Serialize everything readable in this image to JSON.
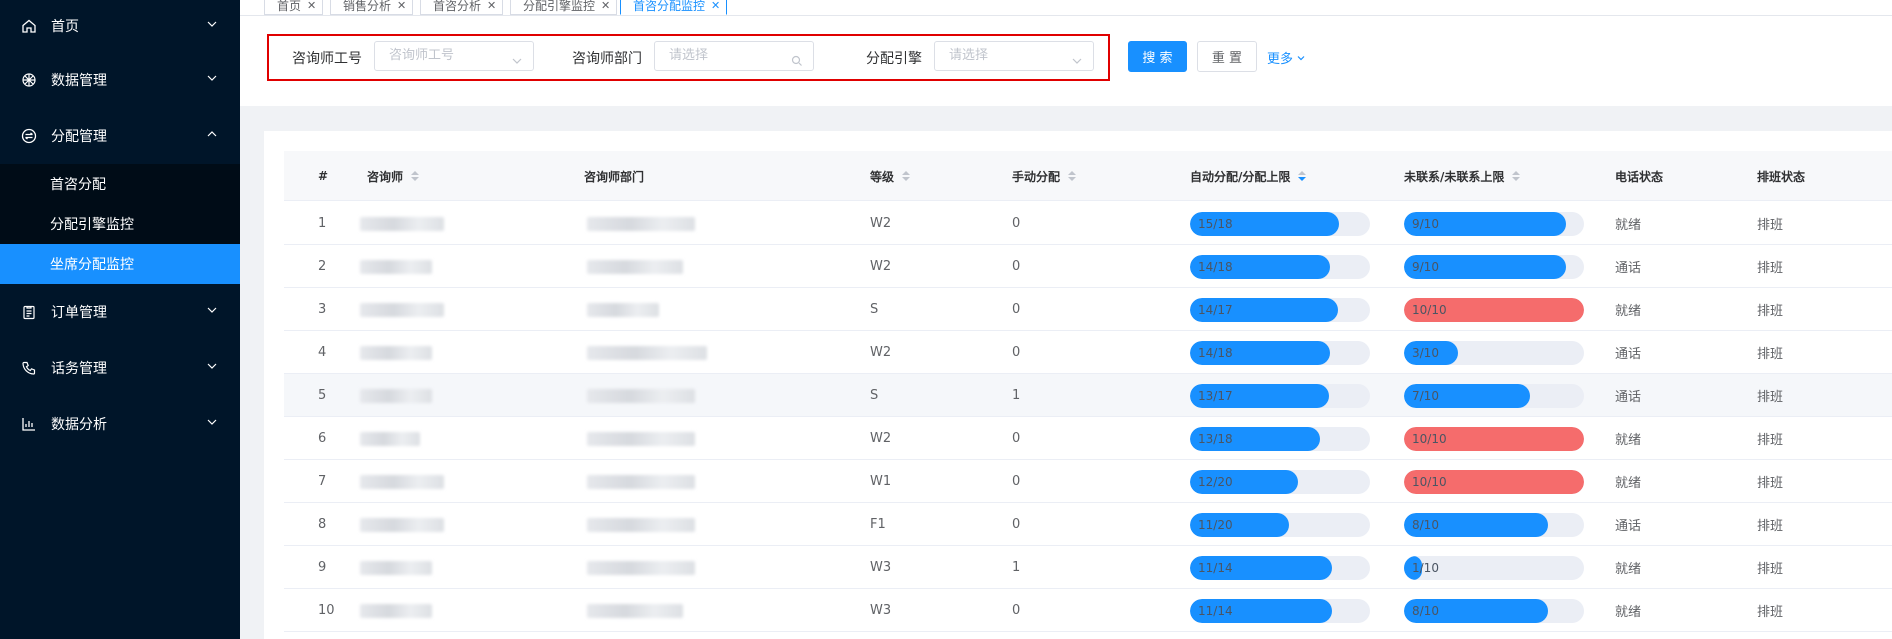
{
  "sidebar": {
    "items": [
      {
        "label": "首页",
        "icon": "home-icon",
        "expanded": false
      },
      {
        "label": "数据管理",
        "icon": "cube-icon",
        "expanded": false
      },
      {
        "label": "分配管理",
        "icon": "distribute-icon",
        "expanded": true,
        "children": [
          {
            "label": "首咨分配",
            "active": false
          },
          {
            "label": "分配引擎监控",
            "active": false
          },
          {
            "label": "坐席分配监控",
            "active": true
          }
        ]
      },
      {
        "label": "订单管理",
        "icon": "clipboard-icon",
        "expanded": false
      },
      {
        "label": "话务管理",
        "icon": "phone-icon",
        "expanded": false
      },
      {
        "label": "数据分析",
        "icon": "bar-chart-icon",
        "expanded": false
      }
    ]
  },
  "tabs": [
    {
      "label": "首页",
      "active": false
    },
    {
      "label": "销售分析",
      "active": false
    },
    {
      "label": "首咨分析",
      "active": false
    },
    {
      "label": "分配引擎监控",
      "active": false
    },
    {
      "label": "首咨分配监控",
      "active": true
    }
  ],
  "search": {
    "field1": {
      "label": "咨询师工号",
      "placeholder": "咨询师工号"
    },
    "field2": {
      "label": "咨询师部门",
      "placeholder": "请选择"
    },
    "field3": {
      "label": "分配引擎",
      "placeholder": "请选择"
    },
    "search_btn": "搜 索",
    "reset_btn": "重 置",
    "more": "更多"
  },
  "colors": {
    "primary": "#1890ff",
    "danger": "#f56c6c",
    "track": "#ebeef5"
  },
  "table": {
    "columns": [
      "#",
      "咨询师",
      "咨询师部门",
      "等级",
      "手动分配",
      "自动分配/分配上限",
      "未联系/未联系上限",
      "电话状态",
      "排班状态"
    ],
    "rows": [
      {
        "idx": "1",
        "level": "W2",
        "manual": "0",
        "auto": "15/18",
        "auto_pct": 0.83,
        "uncontact": "9/10",
        "unc_pct": 0.9,
        "unc_full": false,
        "phone": "就绪",
        "shift": "排班"
      },
      {
        "idx": "2",
        "level": "W2",
        "manual": "0",
        "auto": "14/18",
        "auto_pct": 0.78,
        "uncontact": "9/10",
        "unc_pct": 0.9,
        "unc_full": false,
        "phone": "通话",
        "shift": "排班"
      },
      {
        "idx": "3",
        "level": "S",
        "manual": "0",
        "auto": "14/17",
        "auto_pct": 0.82,
        "uncontact": "10/10",
        "unc_pct": 1.0,
        "unc_full": true,
        "phone": "就绪",
        "shift": "排班"
      },
      {
        "idx": "4",
        "level": "W2",
        "manual": "0",
        "auto": "14/18",
        "auto_pct": 0.78,
        "uncontact": "3/10",
        "unc_pct": 0.3,
        "unc_full": false,
        "phone": "通话",
        "shift": "排班"
      },
      {
        "idx": "5",
        "level": "S",
        "manual": "1",
        "auto": "13/17",
        "auto_pct": 0.77,
        "uncontact": "7/10",
        "unc_pct": 0.7,
        "unc_full": false,
        "phone": "通话",
        "shift": "排班"
      },
      {
        "idx": "6",
        "level": "W2",
        "manual": "0",
        "auto": "13/18",
        "auto_pct": 0.72,
        "uncontact": "10/10",
        "unc_pct": 1.0,
        "unc_full": true,
        "phone": "就绪",
        "shift": "排班"
      },
      {
        "idx": "7",
        "level": "W1",
        "manual": "0",
        "auto": "12/20",
        "auto_pct": 0.6,
        "uncontact": "10/10",
        "unc_pct": 1.0,
        "unc_full": true,
        "phone": "就绪",
        "shift": "排班"
      },
      {
        "idx": "8",
        "level": "F1",
        "manual": "0",
        "auto": "11/20",
        "auto_pct": 0.55,
        "uncontact": "8/10",
        "unc_pct": 0.8,
        "unc_full": false,
        "phone": "通话",
        "shift": "排班"
      },
      {
        "idx": "9",
        "level": "W3",
        "manual": "1",
        "auto": "11/14",
        "auto_pct": 0.79,
        "uncontact": "1/10",
        "unc_pct": 0.1,
        "unc_full": false,
        "phone": "就绪",
        "shift": "排班"
      },
      {
        "idx": "10",
        "level": "W3",
        "manual": "0",
        "auto": "11/14",
        "auto_pct": 0.79,
        "uncontact": "8/10",
        "unc_pct": 0.8,
        "unc_full": false,
        "phone": "就绪",
        "shift": "排班"
      }
    ]
  }
}
